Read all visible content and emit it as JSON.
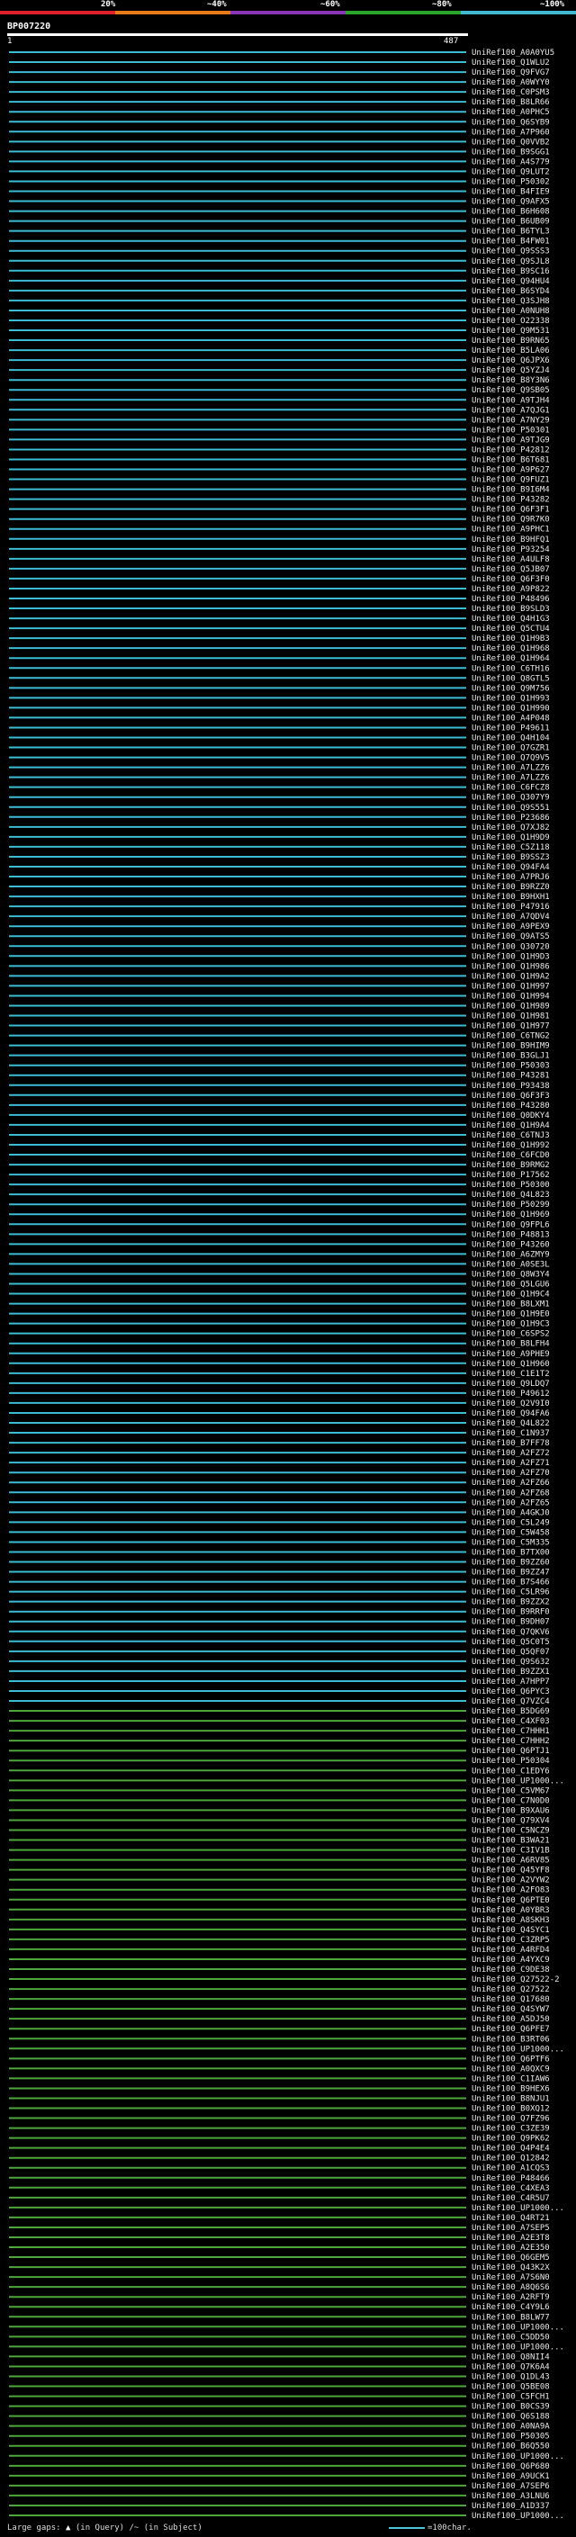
{
  "colorbar": {
    "labels": [
      "20%",
      "~40%",
      "~60%",
      "~80%",
      "~100%"
    ],
    "colors": [
      "#e0202a",
      "#e87a1c",
      "#8a35b8",
      "#2aa62a",
      "#3fb8d0"
    ]
  },
  "query": {
    "id": "BP007220",
    "start": "1",
    "end": "487"
  },
  "hits": {
    "line_color_blue": "#3dbcd4",
    "line_color_green": "#4ea63c",
    "labels": [
      "UniRef100_A0A0YU5",
      "UniRef100_Q1WLU2",
      "UniRef100_Q9FVG7",
      "UniRef100_A0WYY0",
      "UniRef100_C0PSM3",
      "UniRef100_B8LR66",
      "UniRef100_A0PHC5",
      "UniRef100_Q6SYB9",
      "UniRef100_A7P960",
      "UniRef100_Q0VVB2",
      "UniRef100_B9SGG1",
      "UniRef100_A4S779",
      "UniRef100_Q9LUT2",
      "UniRef100_P50302",
      "UniRef100_B4FIE9",
      "UniRef100_Q9AFX5",
      "UniRef100_B6H608",
      "UniRef100_B6UB09",
      "UniRef100_B6TYL3",
      "UniRef100_B4FW01",
      "UniRef100_Q9SSS3",
      "UniRef100_Q9SJL8",
      "UniRef100_B9SC16",
      "UniRef100_Q94HU4",
      "UniRef100_B6SYD4",
      "UniRef100_Q3SJH8",
      "UniRef100_A0NUH8",
      "UniRef100_O22338",
      "UniRef100_Q9M531",
      "UniRef100_B9RN65",
      "UniRef100_B5LA06",
      "UniRef100_Q6JPX6",
      "UniRef100_Q5YZJ4",
      "UniRef100_B8Y3N6",
      "UniRef100_Q9SB05",
      "UniRef100_A9TJH4",
      "UniRef100_A7QJG1",
      "UniRef100_A7NY29",
      "UniRef100_P50301",
      "UniRef100_A9TJG9",
      "UniRef100_P42812",
      "UniRef100_B6T681",
      "UniRef100_A9P627",
      "UniRef100_Q9FUZ1",
      "UniRef100_B9I6M4",
      "UniRef100_P43282",
      "UniRef100_Q6F3F1",
      "UniRef100_Q9R7K0",
      "UniRef100_A9PHC1",
      "UniRef100_B9HFQ1",
      "UniRef100_P93254",
      "UniRef100_A4ULF8",
      "UniRef100_Q5JB07",
      "UniRef100_Q6F3F0",
      "UniRef100_A9P822",
      "UniRef100_P48496",
      "UniRef100_B9SLD3",
      "UniRef100_Q4H1G3",
      "UniRef100_Q5CTU4",
      "UniRef100_Q1H9B3",
      "UniRef100_Q1H968",
      "UniRef100_Q1H964",
      "UniRef100_C6TH16",
      "UniRef100_Q8GTL5",
      "UniRef100_Q9M756",
      "UniRef100_Q1H993",
      "UniRef100_Q1H990",
      "UniRef100_A4P048",
      "UniRef100_P49611",
      "UniRef100_Q4H104",
      "UniRef100_Q7GZR1",
      "UniRef100_Q7Q9V5",
      "UniRef100_A7LZZ6",
      "UniRef100_A7LZZ6",
      "UniRef100_C6FCZ8",
      "UniRef100_Q307Y9",
      "UniRef100_Q9S551",
      "UniRef100_P23686",
      "UniRef100_Q7XJ82",
      "UniRef100_Q1H9D9",
      "UniRef100_C5Z118",
      "UniRef100_B9SSZ3",
      "UniRef100_Q94FA4",
      "UniRef100_A7PRJ6",
      "UniRef100_B9RZZ0",
      "UniRef100_B9HXH1",
      "UniRef100_P47916",
      "UniRef100_A7QDV4",
      "UniRef100_A9PEX9",
      "UniRef100_Q9ATS5",
      "UniRef100_Q30720",
      "UniRef100_Q1H9D3",
      "UniRef100_Q1H986",
      "UniRef100_Q1H9A2",
      "UniRef100_Q1H997",
      "UniRef100_Q1H994",
      "UniRef100_Q1H989",
      "UniRef100_Q1H981",
      "UniRef100_Q1H977",
      "UniRef100_C6TNG2",
      "UniRef100_B9HIM9",
      "UniRef100_B3GLJ1",
      "UniRef100_P50303",
      "UniRef100_P43281",
      "UniRef100_P93438",
      "UniRef100_Q6F3F3",
      "UniRef100_P43280",
      "UniRef100_Q0DKY4",
      "UniRef100_Q1H9A4",
      "UniRef100_C6TNJ3",
      "UniRef100_Q1H992",
      "UniRef100_C6FCD0",
      "UniRef100_B9RMG2",
      "UniRef100_P17562",
      "UniRef100_P50300",
      "UniRef100_Q4L823",
      "UniRef100_P50299",
      "UniRef100_Q1H969",
      "UniRef100_Q9FPL6",
      "UniRef100_P48813",
      "UniRef100_P43260",
      "UniRef100_A6ZMY9",
      "UniRef100_A0SE3L",
      "UniRef100_Q8W3Y4",
      "UniRef100_Q5LGU6",
      "UniRef100_Q1H9C4",
      "UniRef100_B8LXM1",
      "UniRef100_Q1H9E0",
      "UniRef100_Q1H9C3",
      "UniRef100_C6SPS2",
      "UniRef100_B8LFH4",
      "UniRef100_A9PHE9",
      "UniRef100_Q1H960",
      "UniRef100_C1E1T2",
      "UniRef100_Q9LDQ7",
      "UniRef100_P49612",
      "UniRef100_Q2V9I0",
      "UniRef100_Q94FA6",
      "UniRef100_Q4L822",
      "UniRef100_C1N937",
      "UniRef100_B7FF78",
      "UniRef100_A2FZ72",
      "UniRef100_A2FZ71",
      "UniRef100_A2FZ70",
      "UniRef100_A2FZ66",
      "UniRef100_A2FZ68",
      "UniRef100_A2FZ65",
      "UniRef100_A4GKJ0",
      "UniRef100_C5L249",
      "UniRef100_C5W458",
      "UniRef100_C5M335",
      "UniRef100_B7TX00",
      "UniRef100_B9ZZ60",
      "UniRef100_B9ZZ47",
      "UniRef100_B7S466",
      "UniRef100_C5LR96",
      "UniRef100_B9ZZX2",
      "UniRef100_B9RRF0",
      "UniRef100_B9DH07",
      "UniRef100_Q7QKV6",
      "UniRef100_Q5C0T5",
      "UniRef100_Q5QF07",
      "UniRef100_Q9S632",
      "UniRef100_B9ZZX1",
      "UniRef100_A7HPP7",
      "UniRef100_Q6PYC3",
      "UniRef100_Q7VZC4",
      "UniRef100_B5DG69",
      "UniRef100_C4XF03",
      "UniRef100_C7HHH1",
      "UniRef100_C7HHH2",
      "UniRef100_Q6PTJ1",
      "UniRef100_P50304",
      "UniRef100_C1EDY6",
      "UniRef100_UP1000...",
      "UniRef100_C5VM67",
      "UniRef100_C7N0D0",
      "UniRef100_B9XAU6",
      "UniRef100_Q79XV4",
      "UniRef100_C5NCZ9",
      "UniRef100_B3WA21",
      "UniRef100_C3IV1B",
      "UniRef100_A6RV85",
      "UniRef100_Q45YF8",
      "UniRef100_A2VYW2",
      "UniRef100_A2FO83",
      "UniRef100_Q6PTE0",
      "UniRef100_A0YBR3",
      "UniRef100_A8SKH3",
      "UniRef100_Q4SYC1",
      "UniRef100_C3ZRP5",
      "UniRef100_A4RFD4",
      "UniRef100_A4YXC9",
      "UniRef100_C9DE38",
      "UniRef100_Q27522-2",
      "UniRef100_Q27522",
      "UniRef100_Q17680",
      "UniRef100_Q4SYW7",
      "UniRef100_A5DJ50",
      "UniRef100_Q6PFE7",
      "UniRef100_B3RT06",
      "UniRef100_UP1000...",
      "UniRef100_Q6PTF6",
      "UniRef100_A0QXC9",
      "UniRef100_C1IAW6",
      "UniRef100_B9HEX6",
      "UniRef100_B8NJU1",
      "UniRef100_B0XQ12",
      "UniRef100_Q7FZ96",
      "UniRef100_C3ZE39",
      "UniRef100_Q9PK62",
      "UniRef100_Q4P4E4",
      "UniRef100_Q12842",
      "UniRef100_A1CQS3",
      "UniRef100_P48466",
      "UniRef100_C4XEA3",
      "UniRef100_C4R5U7",
      "UniRef100_UP1000...",
      "UniRef100_Q4RT21",
      "UniRef100_A7SEP5",
      "UniRef100_A2E3T8",
      "UniRef100_A2E350",
      "UniRef100_Q6GEM5",
      "UniRef100_Q43K2X",
      "UniRef100_A7S6N0",
      "UniRef100_A8Q6S6",
      "UniRef100_A2RFT9",
      "UniRef100_C4Y9L6",
      "UniRef100_B8LW77",
      "UniRef100_UP1000...",
      "UniRef100_C5DD50",
      "UniRef100_UP1000...",
      "UniRef100_Q8NII4",
      "UniRef100_Q7K6A4",
      "UniRef100_Q1DL43",
      "UniRef100_Q5BE08",
      "UniRef100_C5FCH1",
      "UniRef100_B0CS39",
      "UniRef100_Q6S188",
      "UniRef100_A0NA9A",
      "UniRef100_P50305",
      "UniRef100_B6Q550",
      "UniRef100_UP1000...",
      "UniRef100_Q6P680",
      "UniRef100_A9UCK1",
      "UniRef100_A7SEP6",
      "UniRef100_A3LNU6",
      "UniRef100_A1D337",
      "UniRef100_UP1000..."
    ]
  },
  "footer": {
    "large_gaps_label": "Large gaps:",
    "query_gap_text": "(in Query)",
    "subject_gap_text": "/~ (in Subject)",
    "scale_legend": "=100char."
  }
}
